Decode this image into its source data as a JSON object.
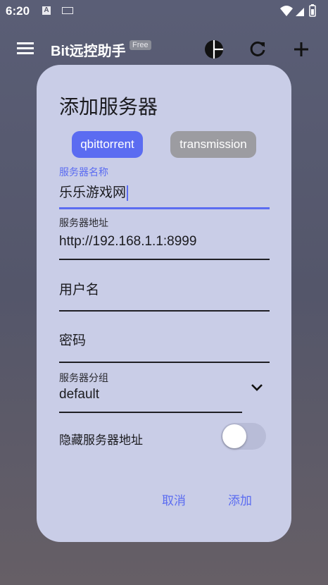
{
  "status_bar": {
    "time": "6:20",
    "notif_a": "A"
  },
  "app_bar": {
    "title": "Bit远控助手",
    "badge": "Free"
  },
  "dialog": {
    "title": "添加服务器",
    "client_tabs": [
      {
        "label": "qbittorrent",
        "selected": true
      },
      {
        "label": "transmission",
        "selected": false
      }
    ],
    "server_name": {
      "label": "服务器名称",
      "value": "乐乐游戏网"
    },
    "server_address": {
      "label": "服务器地址",
      "value": "http://192.168.1.1:8999"
    },
    "username": {
      "placeholder": "用户名"
    },
    "password": {
      "placeholder": "密码"
    },
    "server_group": {
      "label": "服务器分组",
      "value": "default"
    },
    "hide_address": {
      "label": "隐藏服务器地址",
      "enabled": false
    },
    "buttons": {
      "cancel": "取消",
      "add": "添加"
    }
  },
  "colors": {
    "accent": "#5b6cf1",
    "dialog_bg": "#c9cde7",
    "inactive_tab": "#9c9ca1"
  }
}
